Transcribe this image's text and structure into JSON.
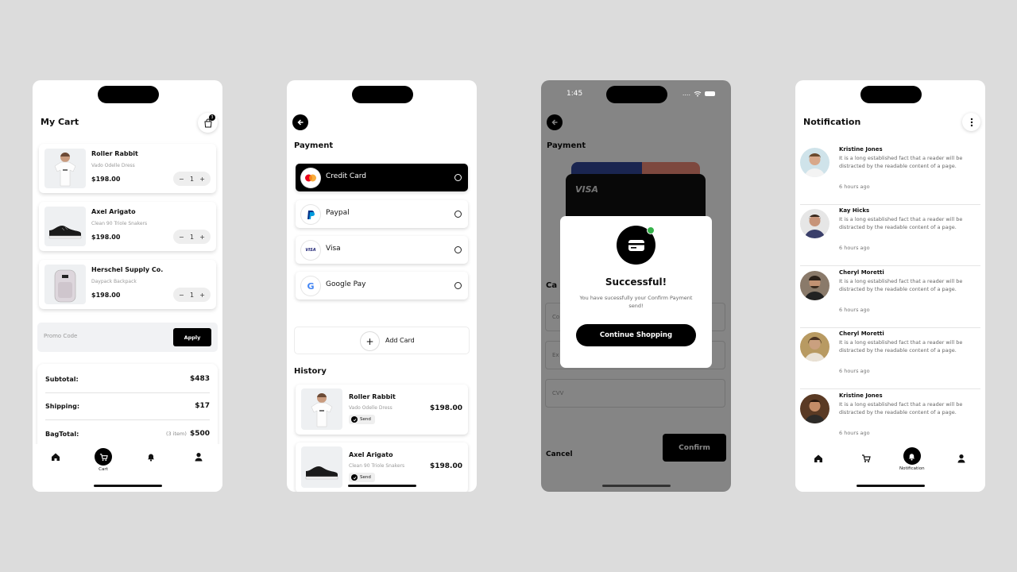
{
  "cart": {
    "title": "My Cart",
    "bag_badge": "3",
    "items": [
      {
        "name": "Roller Rabbit",
        "subtitle": "Vado Odelle Dress",
        "price": "$198.00",
        "qty": "1",
        "minus": "−",
        "plus": "+"
      },
      {
        "name": "Axel Arigato",
        "subtitle": "Clean 90 Triole Snakers",
        "price": "$198.00",
        "qty": "1",
        "minus": "−",
        "plus": "+"
      },
      {
        "name": "Herschel Supply Co.",
        "subtitle": "Daypack Backpack",
        "price": "$198.00",
        "qty": "1",
        "minus": "−",
        "plus": "+"
      }
    ],
    "promo_placeholder": "Promo Code",
    "apply_label": "Apply",
    "subtotal_label": "Subtotal:",
    "subtotal_value": "$483",
    "shipping_label": "Shipping:",
    "shipping_value": "$17",
    "bagtotal_label": "BagTotal:",
    "bagtotal_items": "(3 item)",
    "bagtotal_value": "$500",
    "tabs": {
      "cart_label": "Cart"
    }
  },
  "payment": {
    "section_title": "Payment",
    "options": [
      {
        "name": "Credit Card"
      },
      {
        "name": "Paypal"
      },
      {
        "name": "Visa",
        "logo_text": "VISA"
      },
      {
        "name": "Google Pay",
        "logo_text": "G"
      }
    ],
    "add_card_label": "Add Card",
    "plus": "+",
    "history_title": "History",
    "history": [
      {
        "name": "Roller Rabbit",
        "subtitle": "Vado Odelle Dress",
        "status": "Send",
        "price": "$198.00"
      },
      {
        "name": "Axel Arigato",
        "subtitle": "Clean 90 Triole Snakers",
        "status": "Send",
        "price": "$198.00"
      }
    ]
  },
  "success": {
    "status_time": "1:45",
    "status_signal": "....",
    "section_title": "Payment",
    "card_brand": "VISA",
    "partial_label": "Ca",
    "field1_ph": "Co",
    "field2_ph": "Ex",
    "field3_ph": "CVV",
    "cancel_label": "Cancel",
    "confirm_label": "Confirm",
    "modal_title": "Successful!",
    "modal_message": "You have sucessfully your Confirm Payment send!",
    "continue_label": "Continue Shopping"
  },
  "notifications": {
    "title": "Notification",
    "items": [
      {
        "name": "Kristine Jones",
        "text": "It is a long established fact that a reader will be distracted by the readable content of a page.",
        "time": "6 hours ago"
      },
      {
        "name": "Kay Hicks",
        "text": "It is a long established fact that a reader will be distracted by the readable content of a page.",
        "time": "6 hours ago"
      },
      {
        "name": "Cheryl Moretti",
        "text": "It is a long established fact that a reader will be distracted by the readable content of a page.",
        "time": "6 hours ago"
      },
      {
        "name": "Cheryl Moretti",
        "text": "It is a long established fact that a reader will be distracted by the readable content of a page.",
        "time": "6 hours ago"
      },
      {
        "name": "Kristine Jones",
        "text": "It is a long established fact that a reader will be distracted by the readable content of a page.",
        "time": "6 hours ago"
      }
    ],
    "tabs": {
      "notification_label": "Notification"
    }
  },
  "colors": {
    "primary": "#000000",
    "background": "#dcdcdc",
    "success": "#35b24a"
  }
}
